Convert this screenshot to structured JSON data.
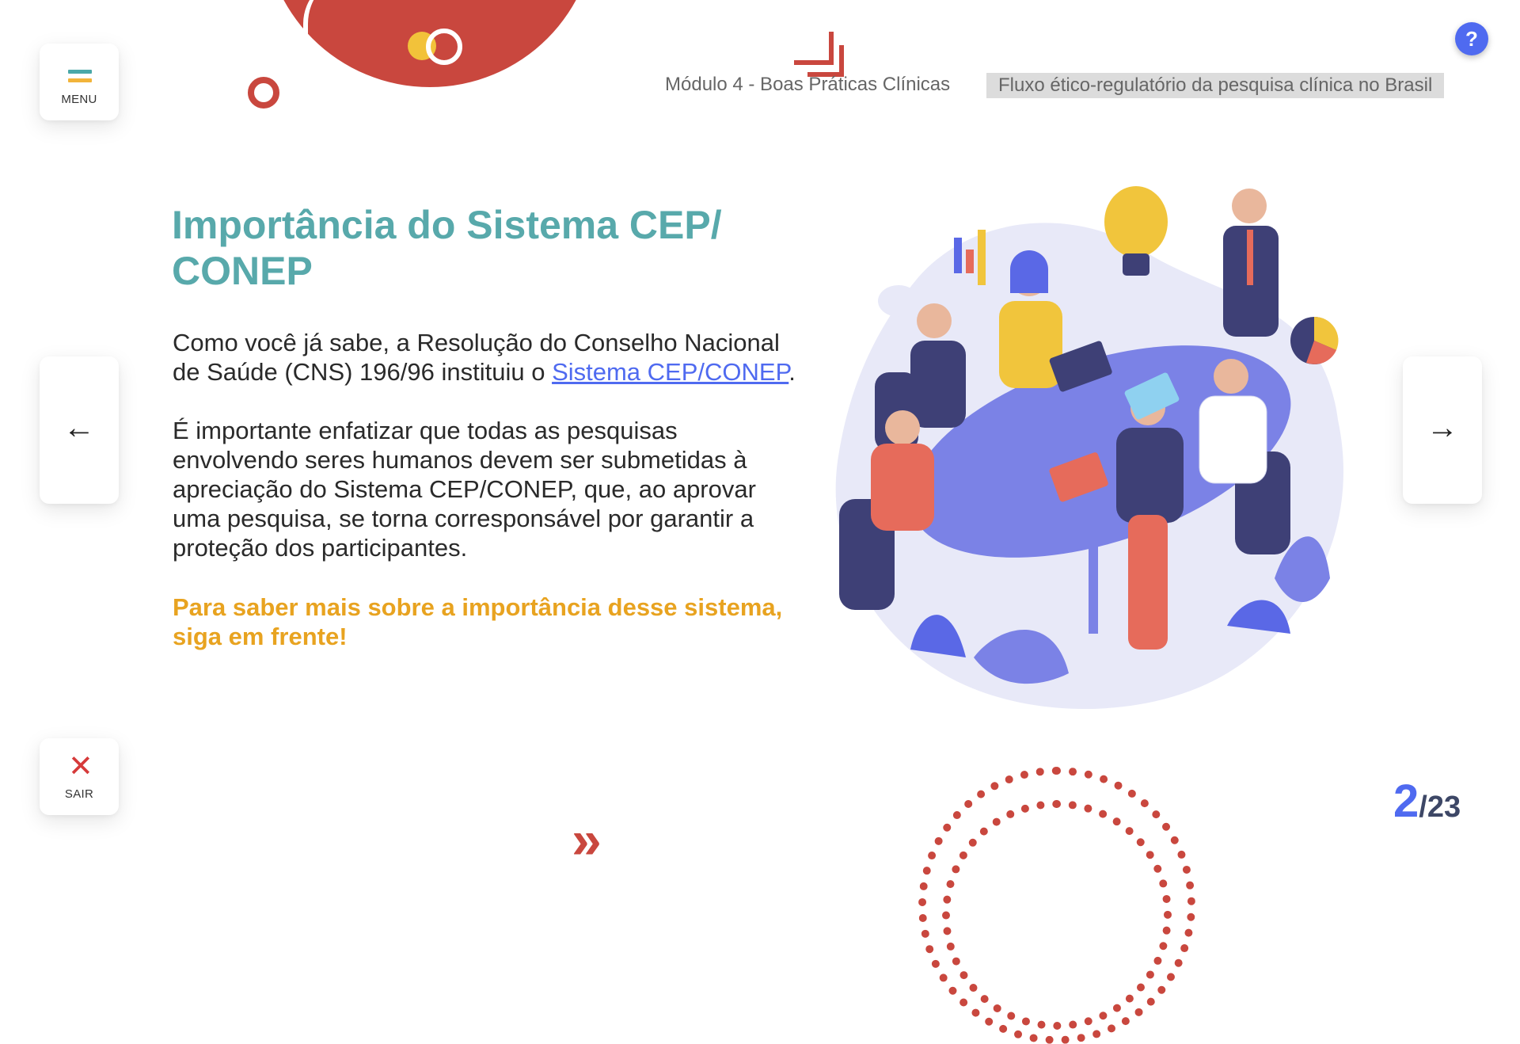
{
  "header": {
    "module": "Módulo 4 - Boas Práticas Clínicas",
    "topic": "Fluxo ético-regulatório da pesquisa clínica no Brasil",
    "help_label": "?"
  },
  "sidebar": {
    "menu_label": "MENU",
    "exit_label": "SAIR",
    "exit_icon": "✕"
  },
  "nav": {
    "prev_arrow": "←",
    "next_arrow": "→"
  },
  "content": {
    "title": "Importância do Sistema CEP/ CONEP",
    "p1_before": "Como você já sabe, a Resolução do Conselho Nacional de Saúde (CNS) 196/96 instituiu o ",
    "p1_link": "Sistema CEP/CONEP",
    "p1_after": ".",
    "p2": "É importante enfatizar que todas as pesquisas envolvendo seres humanos devem ser submetidas à apreciação do Sistema CEP/CONEP, que, ao aprovar uma pesquisa, se torna corresponsável por garantir a proteção dos participantes.",
    "p3": "Para saber mais sobre a importância desse sistema, siga em frente!"
  },
  "pagination": {
    "current": "2",
    "total": "/23"
  },
  "colors": {
    "accent_teal": "#58a9ab",
    "accent_orange": "#e8a320",
    "accent_blue": "#4f6af0",
    "accent_red": "#c9473e"
  },
  "icons": {
    "menu": "hamburger-icon",
    "exit": "close-icon",
    "help": "question-icon",
    "prev": "arrow-left-icon",
    "next": "arrow-right-icon"
  }
}
